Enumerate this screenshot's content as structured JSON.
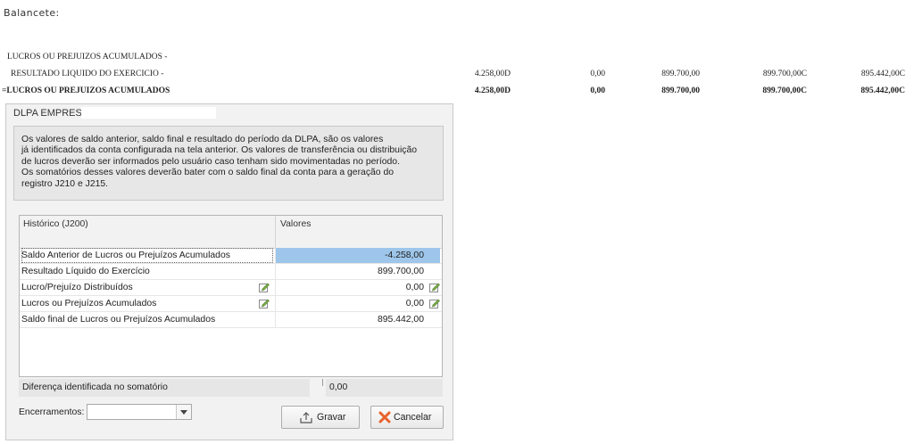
{
  "caption": "Balancete:",
  "balancete": {
    "rows": [
      {
        "label": "LUCROS OU PREJUIZOS ACUMULADOS -",
        "bold": false,
        "values": []
      },
      {
        "label": "RESULTADO LIQUIDO DO EXERCICIO -",
        "bold": false,
        "values": [
          "4.258,00D",
          "0,00",
          "899.700,00",
          "899.700,00C",
          "895.442,00C"
        ]
      },
      {
        "label": "=LUCROS OU PREJUIZOS ACUMULADOS",
        "bold": true,
        "values": [
          "4.258,00D",
          "0,00",
          "899.700,00",
          "899.700,00C",
          "895.442,00C"
        ]
      }
    ]
  },
  "dialog": {
    "title": "DLPA EMPRESA",
    "info_lines": [
      "Os valores de saldo anterior, saldo final e resultado do período da DLPA, são os valores",
      "já identificados da conta configurada na tela anterior. Os valores de transferência ou distribuição",
      "de lucros deverão ser informados pelo usuário caso tenham sido movimentadas no período.",
      "Os somatórios desses valores deverão bater com o saldo final da conta para a geração do",
      "registro J210 e J215."
    ],
    "grid": {
      "col_historico": "Histórico (J200)",
      "col_valores": "Valores",
      "rows": [
        {
          "label": "Saldo Anterior de Lucros ou Prejuízos Acumulados",
          "value": "-4.258,00",
          "selected": true,
          "editable": false
        },
        {
          "label": "Resultado Líquido do Exercício",
          "value": "899.700,00",
          "selected": false,
          "editable": false
        },
        {
          "label": "Lucro/Prejuízo Distribuídos",
          "value": "0,00",
          "selected": false,
          "editable": true
        },
        {
          "label": "Lucros ou Prejuízos Acumulados",
          "value": "0,00",
          "selected": false,
          "editable": true
        },
        {
          "label": "Saldo final de Lucros ou Prejuízos Acumulados",
          "value": "895.442,00",
          "selected": false,
          "editable": false
        }
      ]
    },
    "difference": {
      "label": "Diferença identificada no somatório",
      "value": "0,00"
    },
    "encerramentos": {
      "label": "Encerramentos:",
      "value": ""
    },
    "buttons": {
      "save": "Gravar",
      "cancel": "Cancelar"
    },
    "colors": {
      "selected_cell": "#9ec6ea",
      "cancel_icon": "#e8612c"
    }
  }
}
